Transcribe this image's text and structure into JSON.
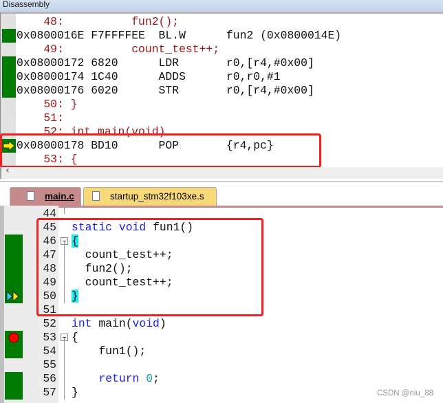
{
  "window": {
    "title": "Disassembly"
  },
  "disassembly": [
    {
      "type": "src",
      "text": "    48:          fun2();"
    },
    {
      "type": "asm",
      "text": "0x0800016E F7FFFFEE  BL.W      fun2 (0x0800014E)"
    },
    {
      "type": "src",
      "text": "    49:          count_test++;"
    },
    {
      "type": "asm",
      "text": "0x08000172 6820      LDR       r0,[r4,#0x00]"
    },
    {
      "type": "asm",
      "text": "0x08000174 1C40      ADDS      r0,r0,#1"
    },
    {
      "type": "asm",
      "text": "0x08000176 6020      STR       r0,[r4,#0x00]"
    },
    {
      "type": "src",
      "text": "    50: }"
    },
    {
      "type": "src",
      "text": "    51:"
    },
    {
      "type": "src",
      "text": "    52: int main(void)"
    },
    {
      "type": "asm",
      "text": "0x08000178 BD10      POP       {r4,pc}",
      "current": true
    },
    {
      "type": "src",
      "text": "    53: {"
    }
  ],
  "tabs": [
    {
      "label": "main.c",
      "active": true
    },
    {
      "label": "startup_stm32f103xe.s",
      "active": false
    }
  ],
  "editor": {
    "lines": [
      {
        "n": "44",
        "code": ""
      },
      {
        "n": "45",
        "code": "static void fun1()"
      },
      {
        "n": "46",
        "code": "{",
        "green": true,
        "fold": true
      },
      {
        "n": "47",
        "code": "  count_test++;",
        "green": true
      },
      {
        "n": "48",
        "code": "  fun2();",
        "green": true
      },
      {
        "n": "49",
        "code": "  count_test++;",
        "green": true
      },
      {
        "n": "50",
        "code": "}",
        "green": true,
        "marker": "current"
      },
      {
        "n": "51",
        "code": ""
      },
      {
        "n": "52",
        "code": "int main(void)"
      },
      {
        "n": "53",
        "code": "{",
        "green": true,
        "fold": true,
        "marker": "breakpoint"
      },
      {
        "n": "54",
        "code": "    fun1();",
        "green": true
      },
      {
        "n": "55",
        "code": ""
      },
      {
        "n": "56",
        "code": "    return 0;",
        "green": true
      },
      {
        "n": "57",
        "code": "}",
        "green": true
      }
    ]
  },
  "watermark": "CSDN @niu_88",
  "colors": {
    "coverage": "#007a00",
    "highlight_box": "#ee2020",
    "source_line": "#a01818",
    "keyword": "#2020e0",
    "brace_match": "#22e8f0"
  }
}
